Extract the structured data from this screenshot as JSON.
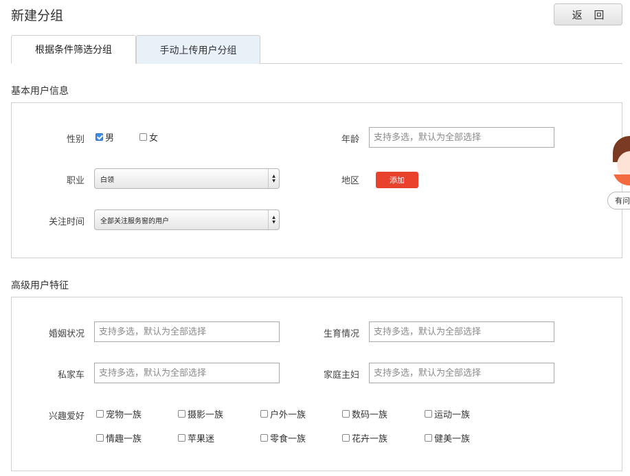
{
  "header": {
    "title": "新建分组",
    "back_label": "返 回"
  },
  "tabs": [
    {
      "label": "根据条件筛选分组",
      "active": true
    },
    {
      "label": "手动上传用户分组",
      "active": false
    }
  ],
  "basic": {
    "title": "基本用户信息",
    "gender_label": "性别",
    "gender_options": [
      {
        "label": "男",
        "checked": true
      },
      {
        "label": "女",
        "checked": false
      }
    ],
    "age_label": "年龄",
    "age_placeholder": "支持多选，默认为全部选择",
    "job_label": "职业",
    "job_value": "白领",
    "region_label": "地区",
    "add_label": "添加",
    "follow_label": "关注时间",
    "follow_value": "全部关注服务窗的用户"
  },
  "advanced": {
    "title": "高级用户特征",
    "marriage_label": "婚姻状况",
    "marriage_placeholder": "支持多选，默认为全部选择",
    "birth_label": "生育情况",
    "birth_placeholder": "支持多选，默认为全部选择",
    "car_label": "私家车",
    "car_placeholder": "支持多选，默认为全部选择",
    "housewife_label": "家庭主妇",
    "housewife_placeholder": "支持多选，默认为全部选择",
    "interest_label": "兴趣爱好",
    "interests": [
      {
        "label": "宠物一族",
        "checked": false
      },
      {
        "label": "摄影一族",
        "checked": false
      },
      {
        "label": "户外一族",
        "checked": false
      },
      {
        "label": "数码一族",
        "checked": false
      },
      {
        "label": "运动一族",
        "checked": false
      },
      {
        "label": "情趣一族",
        "checked": false
      },
      {
        "label": "苹果迷",
        "checked": false
      },
      {
        "label": "零食一族",
        "checked": false
      },
      {
        "label": "花卉一族",
        "checked": false
      },
      {
        "label": "健美一族",
        "checked": false
      }
    ]
  },
  "assistant": {
    "label": "有问"
  },
  "colors": {
    "accent": "#e8412c",
    "tab_inactive_bg": "#e8f0f8",
    "checkbox_checked": "#3d8ee8"
  }
}
